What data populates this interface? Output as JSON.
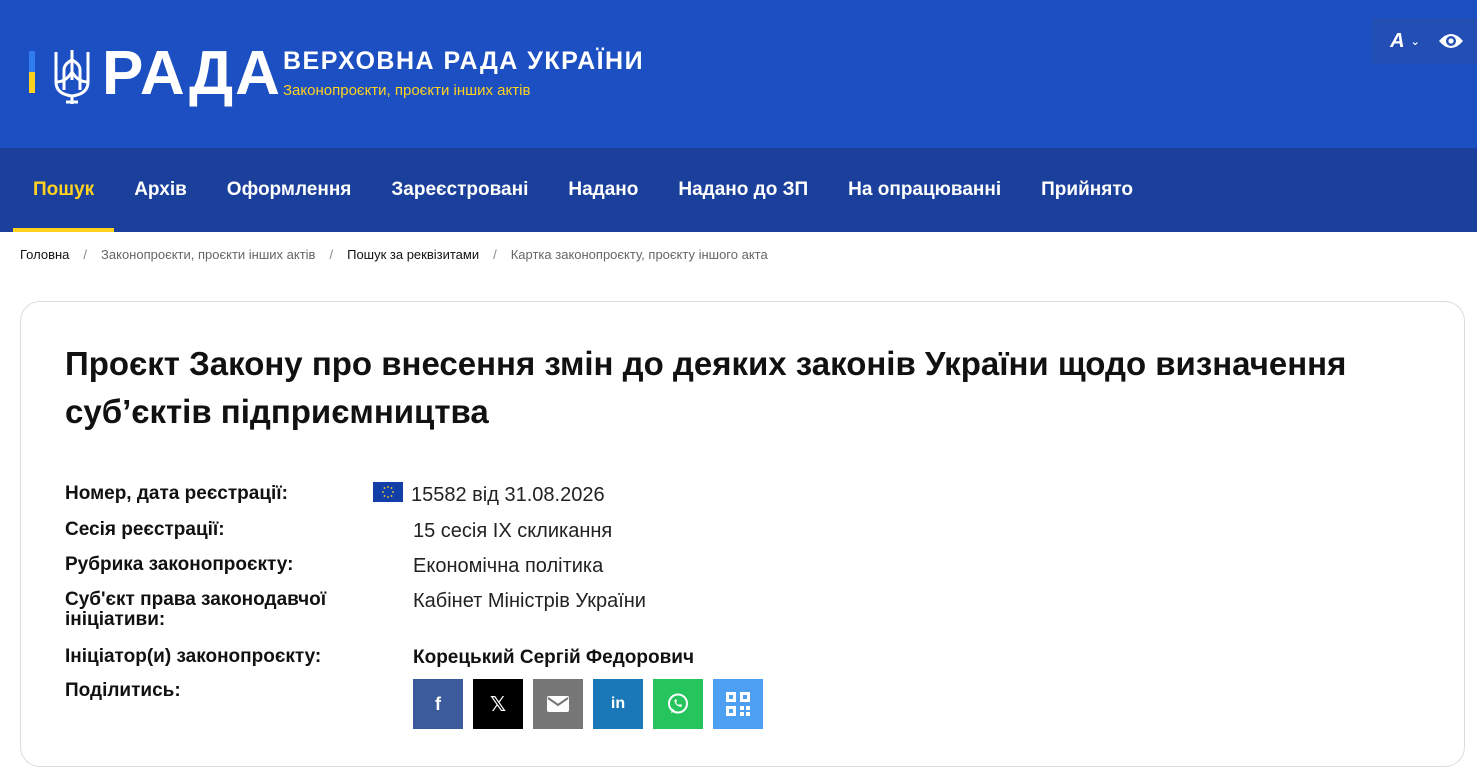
{
  "header": {
    "brand": "РАДА",
    "title": "ВЕРХОВНА РАДА УКРАЇНИ",
    "subtitle": "Законопроєкти, проєкти інших актів",
    "font_button_label": "A",
    "colors": {
      "header_bg": "#1c4fc1",
      "nav_bg": "#1a409c",
      "accent": "#ffd21f"
    }
  },
  "nav": {
    "items": [
      {
        "label": "Пошук",
        "active": true
      },
      {
        "label": "Архів"
      },
      {
        "label": "Оформлення"
      },
      {
        "label": "Зареєстровані"
      },
      {
        "label": "Надано"
      },
      {
        "label": "Надано до ЗП"
      },
      {
        "label": "На опрацюванні"
      },
      {
        "label": "Прийнято"
      }
    ]
  },
  "breadcrumb": [
    "Головна",
    "Законопроєкти, проєкти інших актів",
    "Пошук за реквізитами",
    "Картка законопроєкту, проєкту іншого акта"
  ],
  "bill": {
    "title": "Проєкт Закону про внесення змін до деяких законів України щодо визначення суб’єктів підприємництва",
    "fields": {
      "number_label": "Номер, дата реєстрації:",
      "number_value": "15582 від 31.08.2026",
      "session_label": "Сесія реєстрації:",
      "session_value": "15 сесія IX скликання",
      "rubric_label": "Рубрика законопроєкту:",
      "rubric_value": "Економічна політика",
      "subject_label": "Суб'єкт права законодавчої ініціативи:",
      "subject_value": "Кабінет Міністрів України",
      "initiator_label": "Ініціатор(и) законопроєкту:",
      "initiator_value": "Корецький Сергій Федорович",
      "share_label": "Поділитись:"
    }
  },
  "share": {
    "facebook": "f",
    "x": "𝕏",
    "linkedin": "in",
    "icons": [
      "facebook-icon",
      "x-icon",
      "mail-icon",
      "linkedin-icon",
      "whatsapp-icon",
      "qr-code-icon"
    ]
  }
}
